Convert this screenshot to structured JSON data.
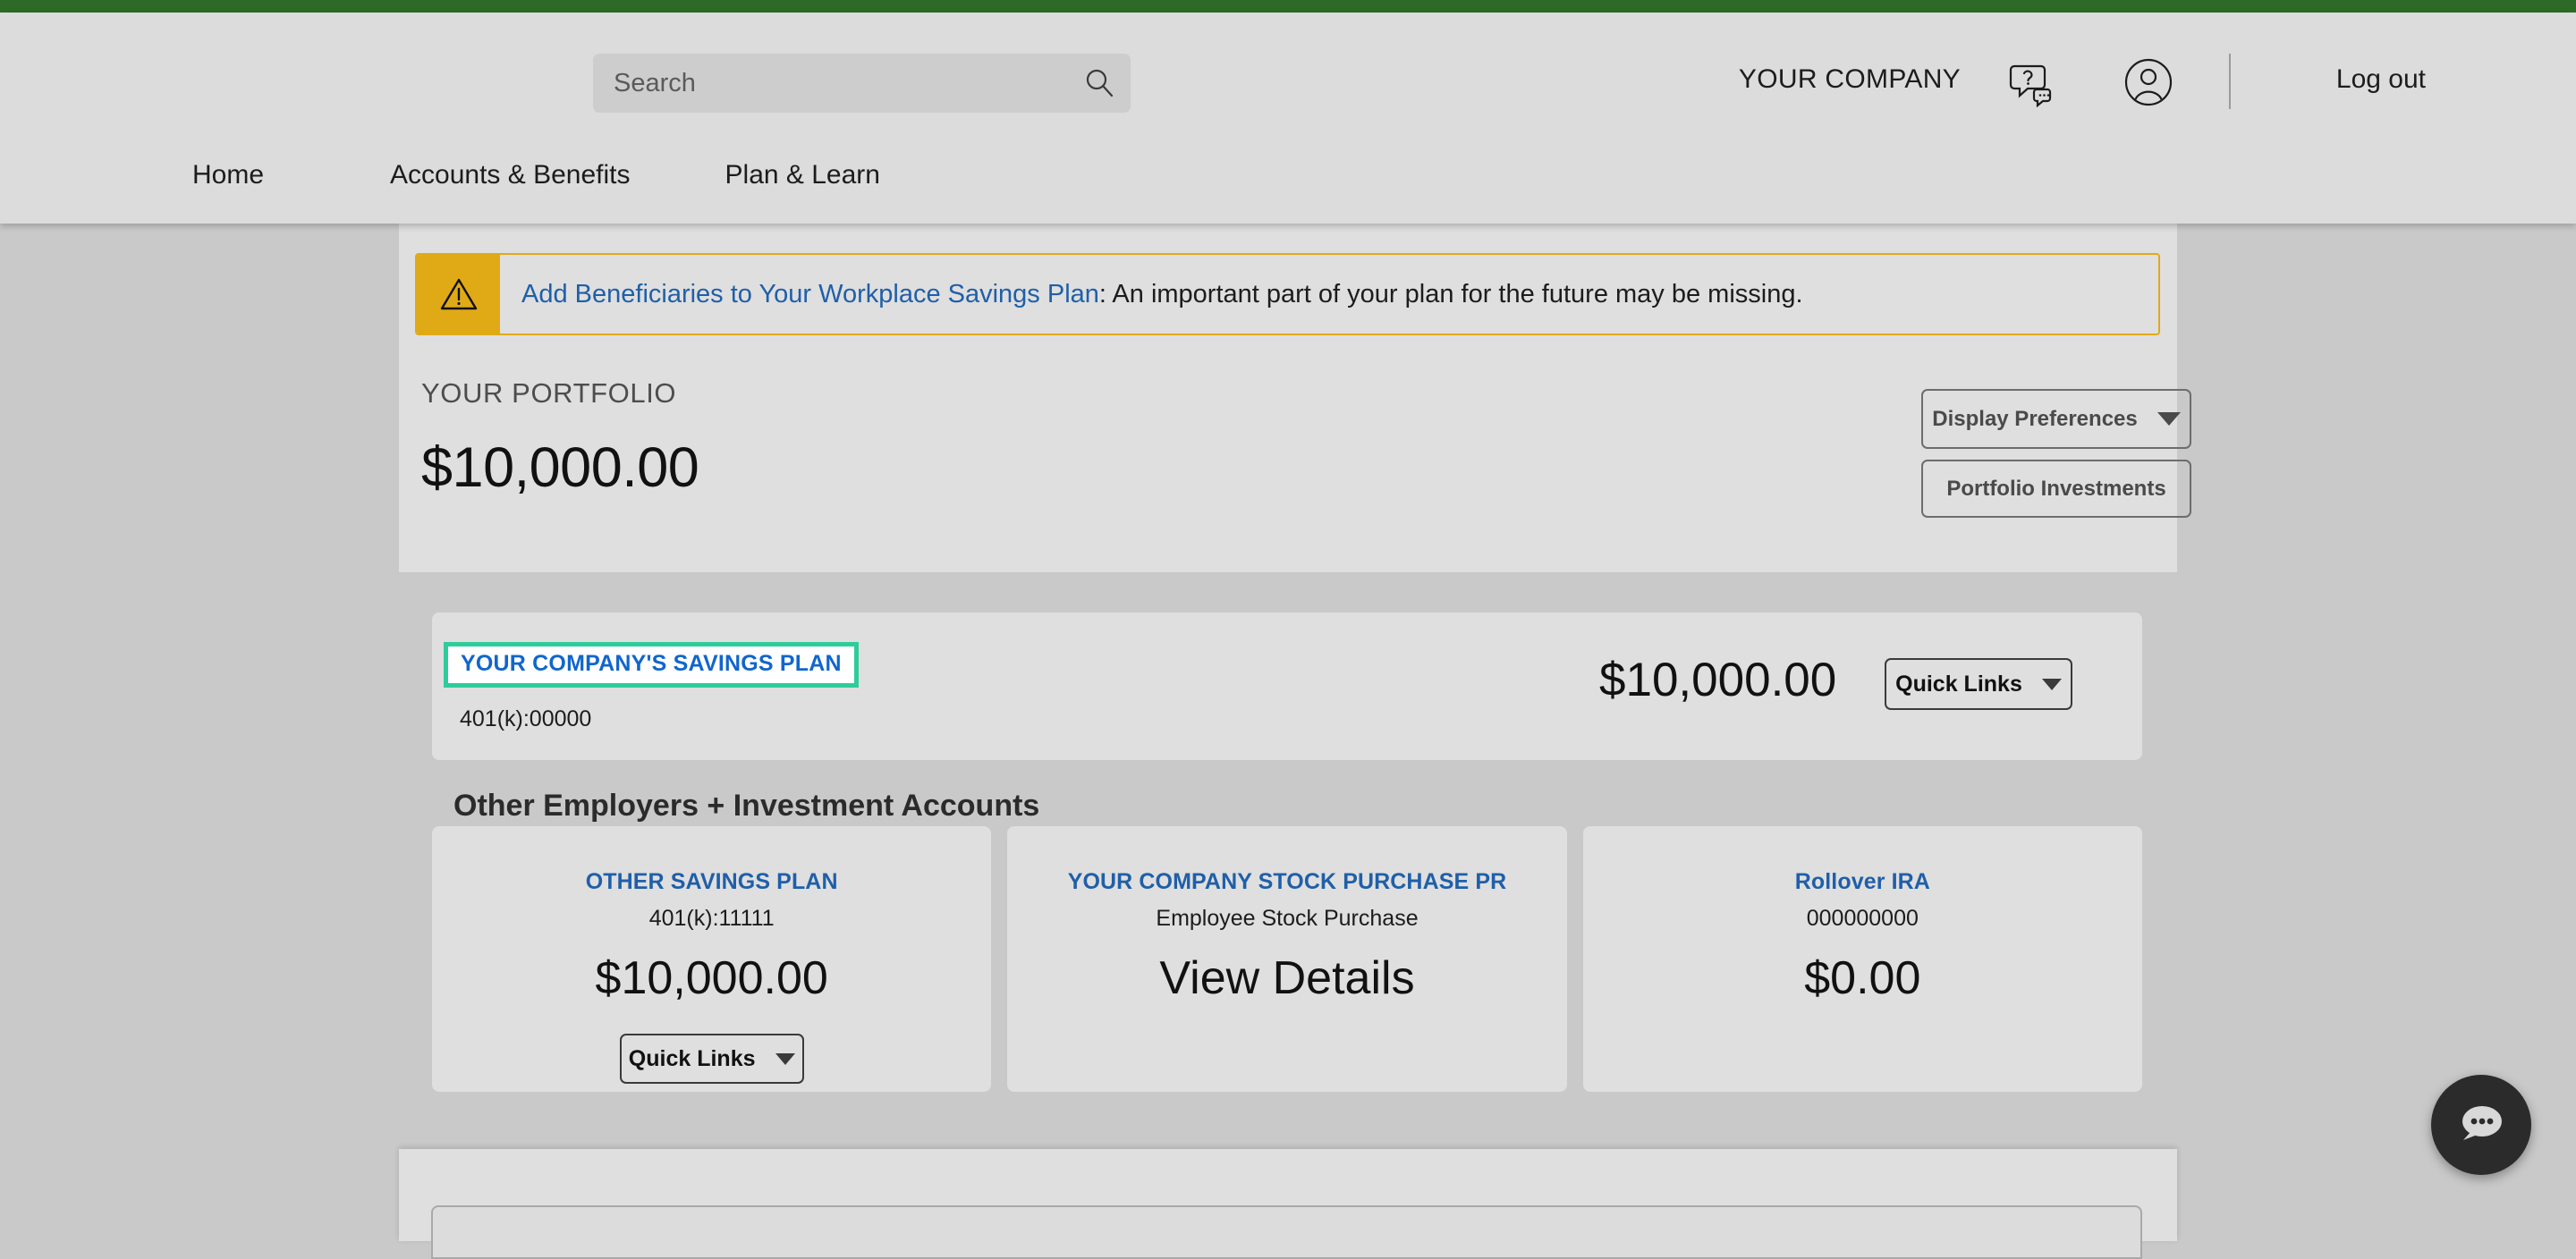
{
  "brand": {
    "accent_green": "#2d6a27"
  },
  "header": {
    "search": {
      "placeholder": "Search",
      "value": "",
      "icon": "search-icon"
    },
    "company_name": "YOUR COMPANY",
    "help_icon": "help-chat-bubble-icon",
    "profile_icon": "user-account-icon",
    "logout_label": "Log out",
    "nav": [
      {
        "label": "Home"
      },
      {
        "label": "Accounts & Benefits"
      },
      {
        "label": "Plan & Learn"
      }
    ]
  },
  "alert": {
    "icon": "warning-triangle-icon",
    "link_text": "Add Beneficiaries to Your Workplace Savings Plan",
    "rest_text": ": An important part of your plan for the future may be missing.",
    "border_color": "#e0aa16"
  },
  "portfolio": {
    "label": "YOUR PORTFOLIO",
    "value": "$10,000.00",
    "display_preferences_label": "Display Preferences",
    "portfolio_investments_label": "Portfolio Investments"
  },
  "plan": {
    "name": "YOUR COMPANY'S SAVINGS PLAN",
    "account_id": "401(k):00000",
    "amount": "$10,000.00",
    "quick_links_label": "Quick Links",
    "focus_ring_color": "#2ecc9a"
  },
  "other_accounts": {
    "heading": "Other Employers + Investment Accounts",
    "cards": [
      {
        "title": "OTHER SAVINGS PLAN",
        "subtitle": "401(k):11111",
        "value": "$10,000.00",
        "quick_links_label": "Quick Links",
        "has_quick_links": true
      },
      {
        "title": "YOUR COMPANY STOCK PURCHASE PR",
        "subtitle": "Employee Stock Purchase",
        "value": "View Details",
        "quick_links_label": "",
        "has_quick_links": false
      },
      {
        "title": "Rollover IRA",
        "subtitle": "000000000",
        "value": "$0.00",
        "quick_links_label": "",
        "has_quick_links": false
      }
    ]
  },
  "chat": {
    "icon": "chat-bubble-icon"
  }
}
